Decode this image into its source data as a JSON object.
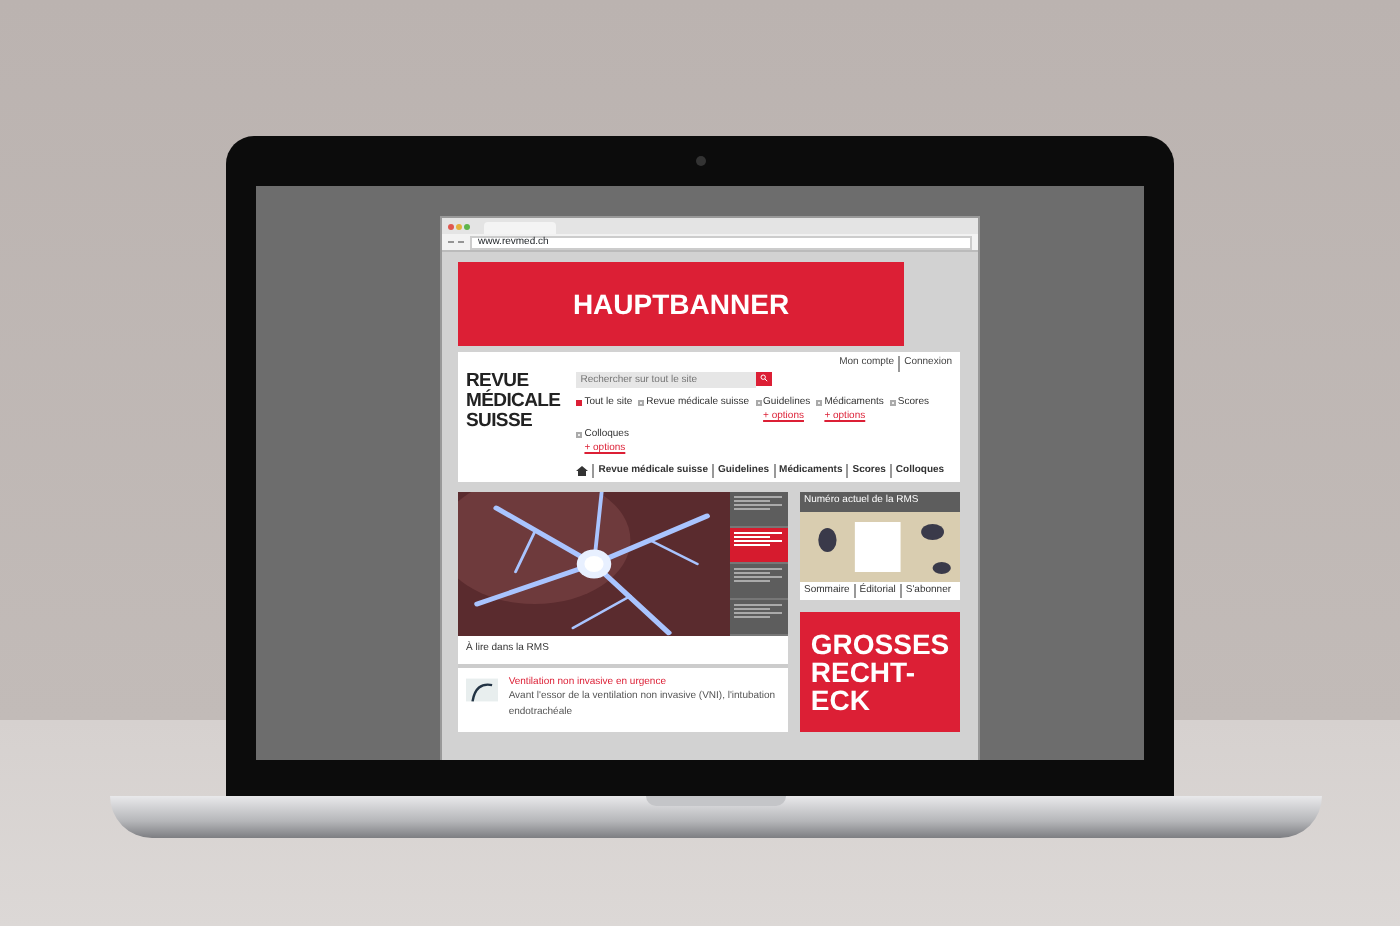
{
  "browser": {
    "url": "www.revmed.ch"
  },
  "banner": {
    "text": "HAUPTBANNER"
  },
  "account_links": [
    "Mon compte",
    "Connexion"
  ],
  "logo": [
    "REVUE",
    "MÉDICALE",
    "SUISSE"
  ],
  "search": {
    "placeholder": "Rechercher sur tout le site"
  },
  "scopes": [
    {
      "label": "Tout le site",
      "selected": true
    },
    {
      "label": "Revue médicale suisse",
      "selected": false
    },
    {
      "label": "Guidelines",
      "selected": false,
      "options": "+ options"
    },
    {
      "label": "Médicaments",
      "selected": false,
      "options": "+ options"
    },
    {
      "label": "Scores",
      "selected": false
    },
    {
      "label": "Colloques",
      "selected": false,
      "options": "+ options"
    }
  ],
  "nav": [
    "Revue médicale suisse",
    "Guidelines",
    "Médicaments",
    "Scores",
    "Colloques"
  ],
  "feature": {
    "kind": "picture",
    "teasers": [
      {
        "highlighted": false
      },
      {
        "highlighted": true
      },
      {
        "highlighted": false
      },
      {
        "highlighted": false
      }
    ]
  },
  "section_title": "À lire dans la RMS",
  "article": {
    "title": "Ventilation non invasive en urgence",
    "excerpt": "Avant l'essor de la ventilation non invasive (VNI), l'intubation endotrachéale"
  },
  "issue": {
    "title": "Numéro actuel de la RMS",
    "links": [
      "Sommaire",
      "Éditorial",
      "S'abonner"
    ]
  },
  "ad": {
    "lines": [
      "GROSSES",
      "RECHT-",
      "ECK"
    ]
  }
}
